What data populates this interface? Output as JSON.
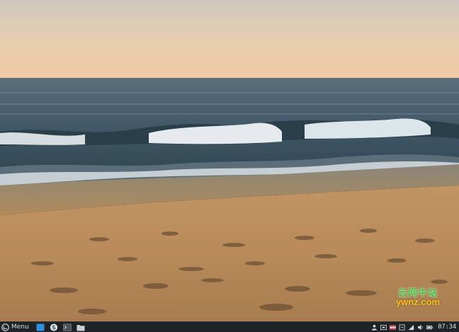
{
  "wallpaper": {
    "subject": "ocean waves breaking on a sandy beach at sunset"
  },
  "watermark": {
    "line1": "云网牛站",
    "line2": "ywnz.com"
  },
  "taskbar": {
    "menu_label": "Menu",
    "launchers": [
      {
        "icon": "show-desktop-icon"
      },
      {
        "icon": "software-center-icon"
      },
      {
        "icon": "terminal-icon"
      },
      {
        "icon": "file-manager-icon"
      }
    ],
    "tray": [
      {
        "icon": "user-icon"
      },
      {
        "icon": "keyboard-layout-icon"
      },
      {
        "icon": "flag-icon"
      },
      {
        "icon": "notification-icon"
      },
      {
        "icon": "network-icon"
      },
      {
        "icon": "volume-icon"
      },
      {
        "icon": "battery-icon"
      }
    ],
    "clock": "07:34",
    "colors": {
      "panel_bg": "#1f2326",
      "accent_blue": "#2f8fe6",
      "text": "#d8dde0"
    }
  }
}
